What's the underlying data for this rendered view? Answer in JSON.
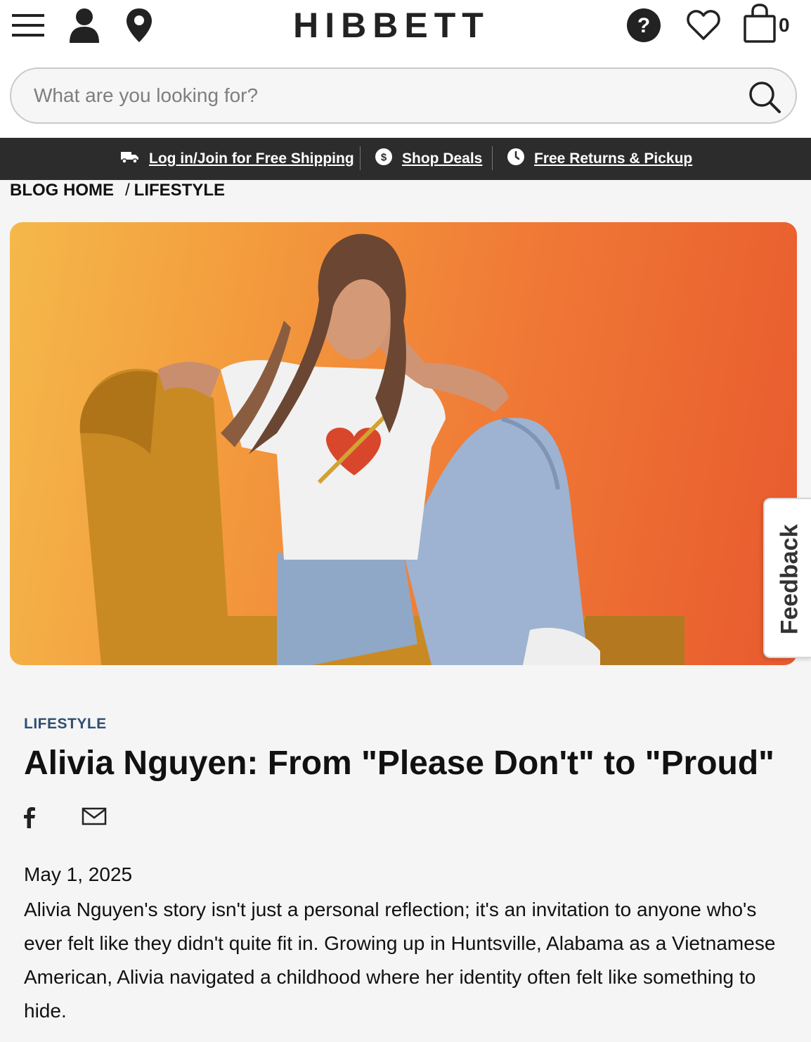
{
  "header": {
    "logo": "HIBBETT",
    "cart_count": "0",
    "icons": [
      "menu-icon",
      "account-icon",
      "store-locator-icon",
      "help-icon",
      "wishlist-icon",
      "cart-icon"
    ]
  },
  "search": {
    "placeholder": "What are you looking for?",
    "value": ""
  },
  "promo_bar": {
    "items": [
      {
        "label": "Log in/Join for Free Shipping",
        "icon": "truck-icon"
      },
      {
        "label": "Shop Deals",
        "icon": "dollar-icon"
      },
      {
        "label": "Free Returns & Pickup",
        "icon": "clock-icon"
      }
    ]
  },
  "breadcrumb": {
    "home": "BLOG HOME",
    "separator": "/",
    "current": "LIFESTYLE"
  },
  "feedback_tab": "Feedback",
  "article": {
    "category": "LIFESTYLE",
    "title": "Alivia Nguyen: From \"Please Don't\" to \"Proud\"",
    "share": [
      "facebook-icon",
      "email-icon"
    ],
    "date": "May 1, 2025",
    "body": "Alivia Nguyen's story isn't just a personal reflection; it's an invitation to anyone who's ever felt like they didn't quite fit in. Growing up in Huntsville, Alabama as a Vietnamese American, Alivia navigated a childhood where her identity often felt like something to hide."
  },
  "colors": {
    "promo_bg": "#2c2c2c",
    "category": "#2d4f72",
    "page_bg": "#f5f5f5"
  }
}
